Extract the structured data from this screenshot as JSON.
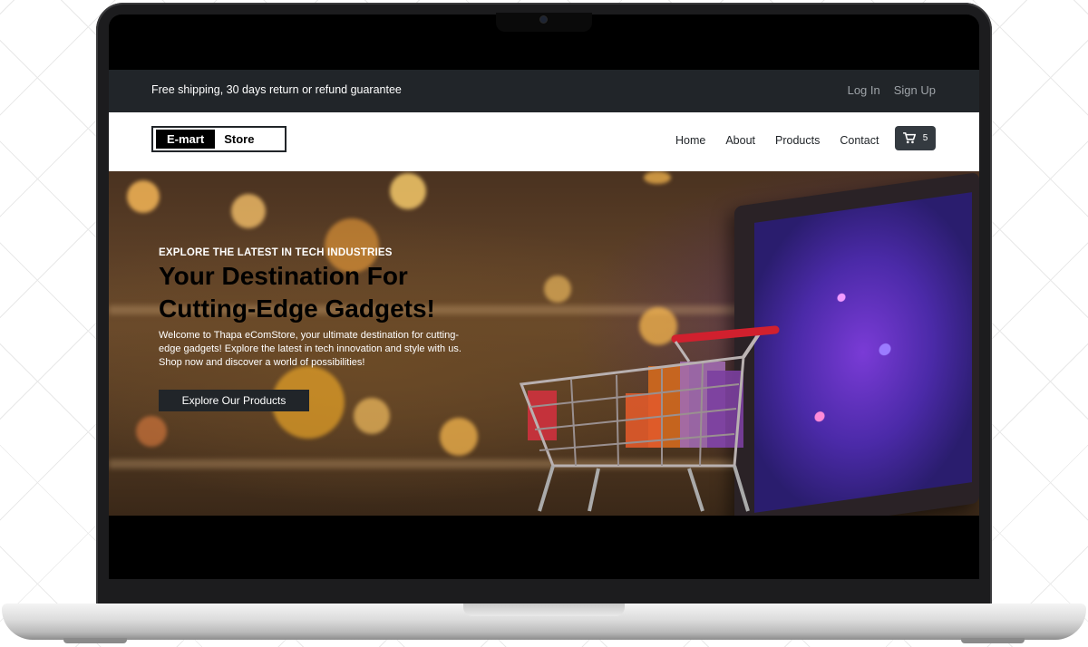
{
  "topbar": {
    "promo": "Free shipping, 30 days return or refund guarantee",
    "login": "Log In",
    "signup": "Sign Up"
  },
  "navbar": {
    "logo_primary": "E-mart",
    "logo_secondary": "Store",
    "menu": [
      "Home",
      "About",
      "Products",
      "Contact"
    ],
    "cart_count": "5",
    "cart_icon": "shopping-cart-icon"
  },
  "hero": {
    "eyebrow": "EXPLORE THE LATEST IN TECH INDUSTRIES",
    "headline": "Your Destination For Cutting-Edge Gadgets!",
    "description": "Welcome to Thapa eComStore, your ultimate destination for cutting-edge gadgets! Explore the latest in tech innovation and style with us. Shop now and discover a world of possibilities!",
    "cta": "Explore Our Products"
  },
  "colors": {
    "topbar_bg": "#212529",
    "navbar_bg": "#ffffff",
    "cart_button_bg": "#343a40",
    "cta_bg": "#212529"
  }
}
